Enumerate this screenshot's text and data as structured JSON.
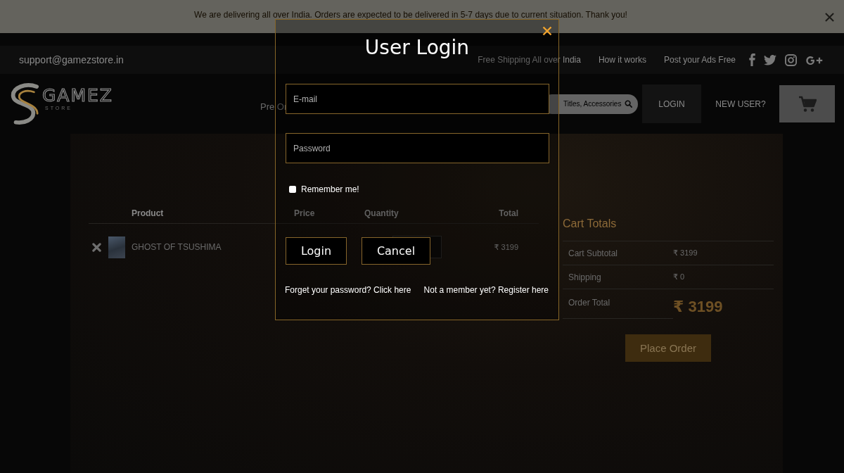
{
  "notice_bar": {
    "message": "We are delivering all over India. Orders are expected to be delivered in 5-7 days due to current situation. Thank you!"
  },
  "top_bar": {
    "email": "support@gamezstore.in",
    "links": [
      "Free Shipping All over India",
      "How it works",
      "Post your Ads Free"
    ]
  },
  "header": {
    "logo": {
      "name": "GAMEZ",
      "tagline": "STORE"
    },
    "nav": [
      "Pre Or"
    ],
    "search": {
      "placeholder": "Titles, Accessories"
    },
    "buttons": [
      "LOGIN",
      "NEW USER?"
    ]
  },
  "cart_table": {
    "columns": [
      "Product",
      "Price",
      "Quantity",
      "Total"
    ],
    "rows": [
      {
        "product": "GHOST OF TSUSHIMA",
        "total": "₹ 3199"
      }
    ]
  },
  "cart_totals": {
    "title": "Cart Totals",
    "rows": [
      {
        "kind": "normal",
        "label": "Cart Subtotal",
        "value": "₹ 3199"
      },
      {
        "kind": "normal",
        "label": "Shipping",
        "value": "₹ 0"
      },
      {
        "kind": "grand",
        "label": "Order Total",
        "value": "₹ 3199"
      }
    ],
    "button": "Place Order"
  },
  "login_modal": {
    "title": "User Login",
    "fields": [
      {
        "placeholder": "E-mail"
      },
      {
        "placeholder": "Password"
      }
    ],
    "remember": {
      "label": "Remember me!",
      "checked": false
    },
    "buttons": [
      "Login",
      "Cancel"
    ],
    "links": [
      "Forget your password? Click here",
      "Not a member yet? Register here"
    ]
  }
}
